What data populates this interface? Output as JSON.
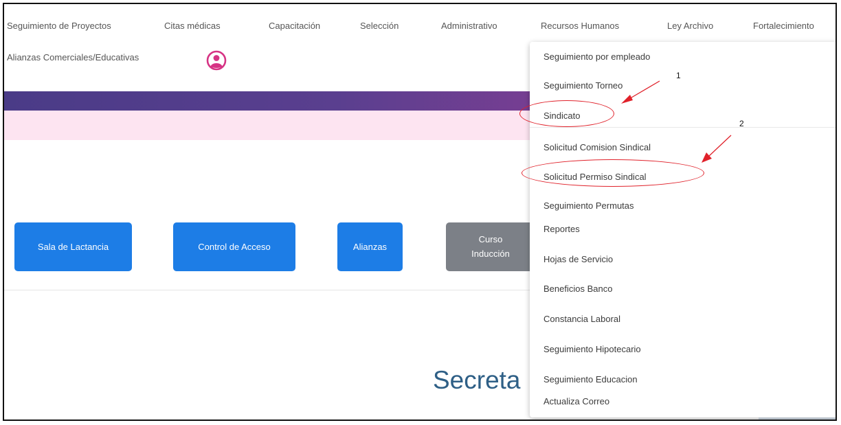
{
  "nav": {
    "items": [
      "Seguimiento de Proyectos",
      "Citas médicas",
      "Capacitación",
      "Selección",
      "Administrativo",
      "Recursos Humanos",
      "Ley Archivo",
      "Fortalecimiento",
      "Alianzas Comerciales/Educativas"
    ],
    "avatar_icon": "user-circle-icon"
  },
  "buttons": {
    "lactancia": "Sala de Lactancia",
    "acceso": "Control de Acceso",
    "alianzas": "Alianzas",
    "curso_line1": "Curso",
    "curso_line2": "Inducción"
  },
  "main": {
    "heading": "Secreta"
  },
  "dropdown": {
    "items": [
      "Seguimiento por empleado",
      "Seguimiento Torneo",
      "Sindicato",
      "Solicitud Comision Sindical",
      "Solicitud Permiso Sindical",
      "Seguimiento Permutas",
      "Reportes",
      "Hojas de Servicio",
      "Beneficios Banco",
      "Constancia Laboral",
      "Seguimiento Hipotecario",
      "Seguimiento Educacion",
      "Actualiza Correo"
    ]
  },
  "annotations": {
    "callout_1": "1",
    "callout_2": "2"
  },
  "colors": {
    "accent_button": "#1d7de6",
    "disabled_button": "#7c8087",
    "header_band": "#5a3f8f",
    "pink_band": "#fde4f1",
    "avatar": "#d63384",
    "annotation_red": "#e0212a"
  }
}
